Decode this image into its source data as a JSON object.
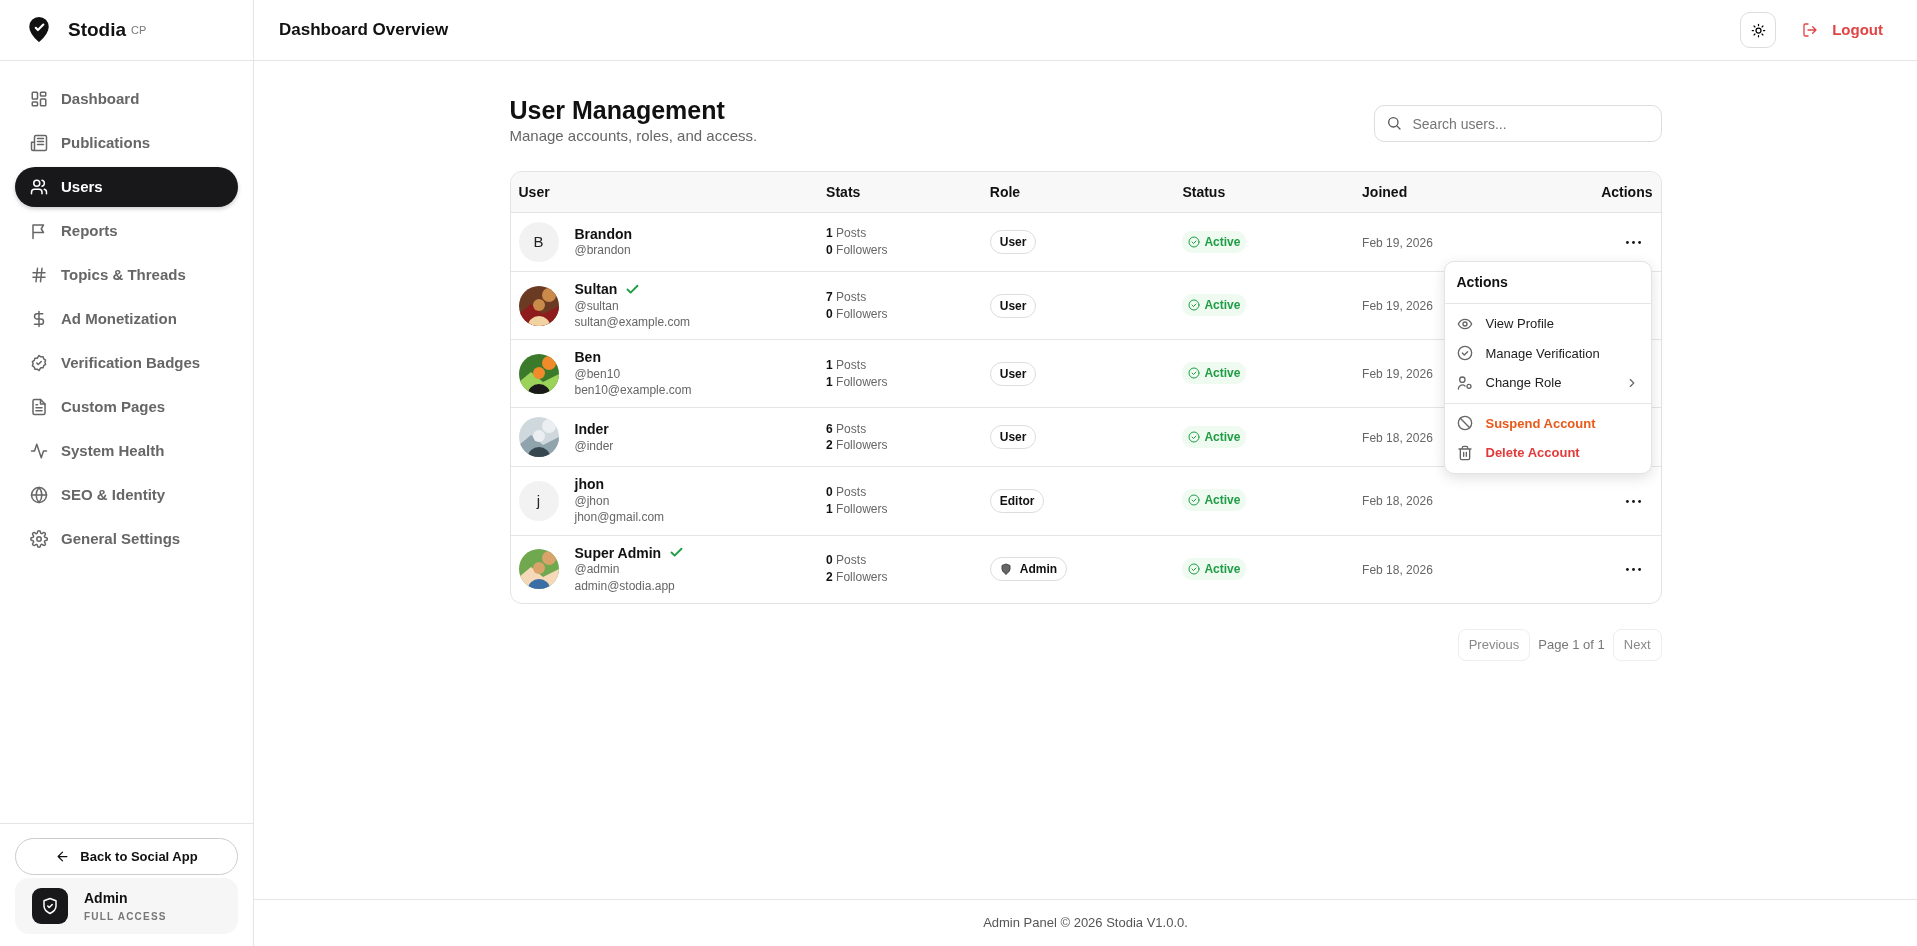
{
  "brand": {
    "name": "Stodia",
    "suffix": "CP"
  },
  "sidebar": {
    "items": [
      {
        "label": "Dashboard",
        "selected": false
      },
      {
        "label": "Publications",
        "selected": false
      },
      {
        "label": "Users",
        "selected": true
      },
      {
        "label": "Reports",
        "selected": false
      },
      {
        "label": "Topics & Threads",
        "selected": false
      },
      {
        "label": "Ad Monetization",
        "selected": false
      },
      {
        "label": "Verification Badges",
        "selected": false
      },
      {
        "label": "Custom Pages",
        "selected": false
      },
      {
        "label": "System Health",
        "selected": false
      },
      {
        "label": "SEO & Identity",
        "selected": false
      },
      {
        "label": "General Settings",
        "selected": false
      }
    ],
    "back_button": "Back to Social App",
    "account": {
      "name": "Admin",
      "role": "FULL ACCESS"
    }
  },
  "header": {
    "title": "Dashboard Overview",
    "logout": "Logout"
  },
  "page": {
    "title": "User Management",
    "subtitle": "Manage accounts, roles, and access.",
    "search": {
      "placeholder": "Search users..."
    }
  },
  "table": {
    "columns": [
      "User",
      "Stats",
      "Role",
      "Status",
      "Joined",
      "Actions"
    ],
    "rows": [
      {
        "avatar": {
          "kind": "initial",
          "text": "B"
        },
        "name": "Brandon",
        "verified": false,
        "handle": "@brandon",
        "posts": "**1** Posts",
        "followers": "**0** Followers",
        "role": {
          "label": "User",
          "kind": "standard"
        },
        "status": {
          "label": "Active",
          "kind": "active"
        },
        "joined": "Feb 19, 2026",
        "menu_button_visible": true
      },
      {
        "name": "Sultan",
        "verified": true,
        "handle": "@sultan",
        "email": "sultan@example.com",
        "posts": "**7** Posts",
        "followers": "**0** Followers",
        "role": {
          "label": "User",
          "kind": "standard"
        },
        "status": {
          "label": "Active",
          "kind": "active"
        },
        "joined": "Feb 19, 2026",
        "menu_button_visible": false
      },
      {
        "name": "Ben",
        "verified": false,
        "handle": "@ben10",
        "email": "ben10@example.com",
        "posts": "**1** Posts",
        "followers": "**1** Followers",
        "role": {
          "label": "User",
          "kind": "standard"
        },
        "status": {
          "label": "Active",
          "kind": "active"
        },
        "joined": "Feb 19, 2026",
        "menu_button_visible": false
      },
      {
        "name": "Inder",
        "verified": false,
        "handle": "@inder",
        "posts": "**6** Posts",
        "followers": "**2** Followers",
        "role": {
          "label": "User",
          "kind": "standard"
        },
        "status": {
          "label": "Active",
          "kind": "active"
        },
        "joined": "Feb 18, 2026",
        "menu_button_visible": false
      },
      {
        "avatar": {
          "kind": "initial",
          "text": "j"
        },
        "name": "jhon",
        "verified": false,
        "handle": "@jhon",
        "email": "jhon@gmail.com",
        "posts": "**0** Posts",
        "followers": "**1** Followers",
        "role": {
          "label": "Editor",
          "kind": "standard"
        },
        "status": {
          "label": "Active",
          "kind": "active"
        },
        "joined": "Feb 18, 2026",
        "menu_button_visible": true
      },
      {
        "name": "Super Admin",
        "verified": true,
        "handle": "@admin",
        "email": "admin@stodia.app",
        "posts": "**0** Posts",
        "followers": "**2** Followers",
        "role": {
          "label": "Admin",
          "kind": "admin"
        },
        "status": {
          "label": "Active",
          "kind": "active"
        },
        "joined": "Feb 18, 2026",
        "menu_button_visible": true
      }
    ]
  },
  "actions_menu": {
    "title": "Actions",
    "groups": [
      {
        "items": [
          {
            "label": "View Profile",
            "kind": "normal",
            "submenu": false
          },
          {
            "label": "Manage Verification",
            "kind": "normal",
            "submenu": false
          },
          {
            "label": "Change Role",
            "kind": "normal",
            "submenu": true
          }
        ]
      },
      {
        "items": [
          {
            "label": "Suspend Account",
            "kind": "warning",
            "submenu": false
          },
          {
            "label": "Delete Account",
            "kind": "danger",
            "submenu": false
          }
        ]
      }
    ]
  },
  "pagination": {
    "previous": {
      "label": "Previous",
      "disabled": true
    },
    "page_info": "Page 1 of 1",
    "next": {
      "label": "Next",
      "disabled": true
    }
  },
  "footer": "Admin Panel © 2026 Stodia V1.0.0."
}
